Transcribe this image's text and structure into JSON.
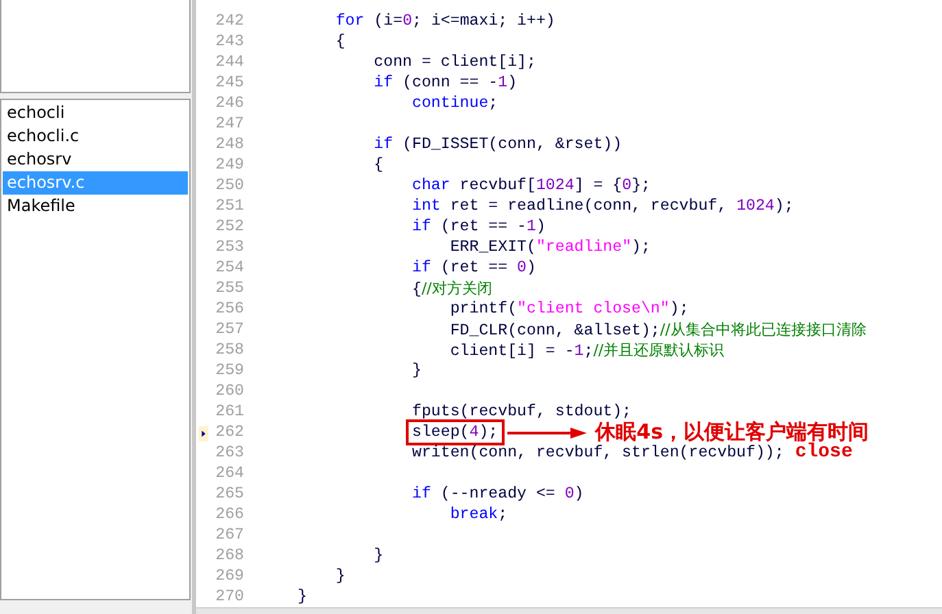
{
  "files": [
    {
      "name": "echocli",
      "selected": false
    },
    {
      "name": "echocli.c",
      "selected": false
    },
    {
      "name": "echosrv",
      "selected": false
    },
    {
      "name": "echosrv.c",
      "selected": true
    },
    {
      "name": "Makefile",
      "selected": false
    }
  ],
  "code_lines": [
    {
      "number": "242",
      "tokens": [
        {
          "kind": "keyword",
          "text": "    for"
        },
        {
          "kind": "plain",
          "text": " (i="
        },
        {
          "kind": "number",
          "text": "0"
        },
        {
          "kind": "plain",
          "text": "; i<=maxi; i++)"
        }
      ]
    },
    {
      "number": "243",
      "tokens": [
        {
          "kind": "plain",
          "text": "    {"
        }
      ]
    },
    {
      "number": "244",
      "tokens": [
        {
          "kind": "plain",
          "text": "        conn = client[i];"
        }
      ]
    },
    {
      "number": "245",
      "tokens": [
        {
          "kind": "keyword",
          "text": "        if"
        },
        {
          "kind": "plain",
          "text": " (conn == -"
        },
        {
          "kind": "number",
          "text": "1"
        },
        {
          "kind": "plain",
          "text": ")"
        }
      ]
    },
    {
      "number": "246",
      "tokens": [
        {
          "kind": "keyword",
          "text": "            continue"
        },
        {
          "kind": "plain",
          "text": ";"
        }
      ]
    },
    {
      "number": "247"
    },
    {
      "number": "248",
      "tokens": [
        {
          "kind": "keyword",
          "text": "        if"
        },
        {
          "kind": "plain",
          "text": " (FD_ISSET(conn, &rset))"
        }
      ]
    },
    {
      "number": "249",
      "tokens": [
        {
          "kind": "plain",
          "text": "        {"
        }
      ]
    },
    {
      "number": "250",
      "tokens": [
        {
          "kind": "keyword",
          "text": "            char"
        },
        {
          "kind": "plain",
          "text": " recvbuf["
        },
        {
          "kind": "number",
          "text": "1024"
        },
        {
          "kind": "plain",
          "text": "] = {"
        },
        {
          "kind": "number",
          "text": "0"
        },
        {
          "kind": "plain",
          "text": "};"
        }
      ]
    },
    {
      "number": "251",
      "tokens": [
        {
          "kind": "keyword",
          "text": "            int"
        },
        {
          "kind": "plain",
          "text": " ret = readline(conn, recvbuf, "
        },
        {
          "kind": "number",
          "text": "1024"
        },
        {
          "kind": "plain",
          "text": ");"
        }
      ]
    },
    {
      "number": "252",
      "tokens": [
        {
          "kind": "keyword",
          "text": "            if"
        },
        {
          "kind": "plain",
          "text": " (ret == -"
        },
        {
          "kind": "number",
          "text": "1"
        },
        {
          "kind": "plain",
          "text": ")"
        }
      ]
    },
    {
      "number": "253",
      "tokens": [
        {
          "kind": "plain",
          "text": "                ERR_EXIT("
        },
        {
          "kind": "string",
          "text": "\"readline\""
        },
        {
          "kind": "plain",
          "text": ");"
        }
      ]
    },
    {
      "number": "254",
      "tokens": [
        {
          "kind": "keyword",
          "text": "            if"
        },
        {
          "kind": "plain",
          "text": " (ret == "
        },
        {
          "kind": "number",
          "text": "0"
        },
        {
          "kind": "plain",
          "text": ")"
        }
      ]
    },
    {
      "number": "255",
      "tokens": [
        {
          "kind": "plain",
          "text": "            {"
        },
        {
          "kind": "comment",
          "text": "//对方关闭"
        }
      ]
    },
    {
      "number": "256",
      "tokens": [
        {
          "kind": "plain",
          "text": "                printf("
        },
        {
          "kind": "string",
          "text": "\"client close\\n\""
        },
        {
          "kind": "plain",
          "text": ");"
        }
      ]
    },
    {
      "number": "257",
      "tokens": [
        {
          "kind": "plain",
          "text": "                FD_CLR(conn, &allset);"
        },
        {
          "kind": "comment",
          "text": "//从集合中将此已连接接口清除"
        }
      ]
    },
    {
      "number": "258",
      "tokens": [
        {
          "kind": "plain",
          "text": "                client[i] = -"
        },
        {
          "kind": "number",
          "text": "1"
        },
        {
          "kind": "plain",
          "text": ";"
        },
        {
          "kind": "comment",
          "text": "//并且还原默认标识"
        }
      ]
    },
    {
      "number": "259",
      "tokens": [
        {
          "kind": "plain",
          "text": "            }"
        }
      ]
    },
    {
      "number": "260"
    },
    {
      "number": "261",
      "tokens": [
        {
          "kind": "plain",
          "text": "            fputs(recvbuf, stdout);"
        }
      ]
    },
    {
      "number": "262",
      "bookmark": true,
      "boxed": true,
      "note": "休眠4s，以便让客户端有时间",
      "tokens": [
        {
          "kind": "plain",
          "text": "            sleep("
        },
        {
          "kind": "number",
          "text": "4"
        },
        {
          "kind": "plain",
          "text": ");"
        }
      ]
    },
    {
      "number": "263",
      "note": "close",
      "tokens": [
        {
          "kind": "plain",
          "text": "            writen(conn, recvbuf, strlen(recvbuf));"
        }
      ]
    },
    {
      "number": "264"
    },
    {
      "number": "265",
      "tokens": [
        {
          "kind": "keyword",
          "text": "            if"
        },
        {
          "kind": "plain",
          "text": " (--nready <= "
        },
        {
          "kind": "number",
          "text": "0"
        },
        {
          "kind": "plain",
          "text": ")"
        }
      ]
    },
    {
      "number": "266",
      "tokens": [
        {
          "kind": "keyword",
          "text": "                break"
        },
        {
          "kind": "plain",
          "text": ";"
        }
      ]
    },
    {
      "number": "267"
    },
    {
      "number": "268",
      "tokens": [
        {
          "kind": "plain",
          "text": "        }"
        }
      ]
    },
    {
      "number": "269",
      "tokens": [
        {
          "kind": "plain",
          "text": "    }"
        }
      ]
    },
    {
      "number": "270",
      "tokens": [
        {
          "kind": "plain",
          "text": "}"
        }
      ]
    }
  ]
}
